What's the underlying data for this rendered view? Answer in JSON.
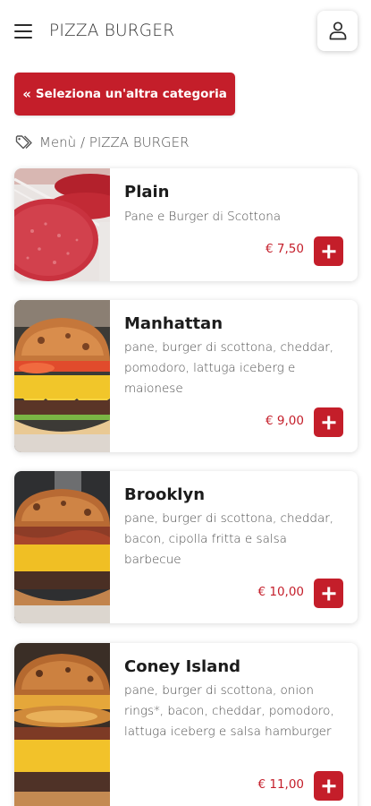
{
  "header": {
    "title": "PIZZA BURGER",
    "menu_icon": "hamburger-menu-icon",
    "account_icon": "user-icon"
  },
  "category_button": {
    "icon": "double-chevron-left-icon",
    "label": "Seleziona un'altra categoria"
  },
  "breadcrumb": {
    "icon": "tags-icon",
    "text": "Menù / PIZZA BURGER"
  },
  "products": [
    {
      "name": "Plain",
      "description": "Pane e Burger di Scottona",
      "price": "€ 7,50"
    },
    {
      "name": "Manhattan",
      "description": "pane, burger di scottona, cheddar, pomodoro, lattuga iceberg e maionese",
      "price": "€ 9,00"
    },
    {
      "name": "Brooklyn",
      "description": "pane, burger di scottona, cheddar, bacon, cipolla fritta e salsa barbecue",
      "price": "€ 10,00"
    },
    {
      "name": "Coney Island",
      "description": "pane, burger di scottona, onion rings*, bacon, cheddar, pomodoro, lattuga iceberg e salsa hamburger",
      "price": "€ 11,00"
    }
  ],
  "colors": {
    "accent": "#c41e2a",
    "text": "#222222",
    "muted": "#555555"
  }
}
